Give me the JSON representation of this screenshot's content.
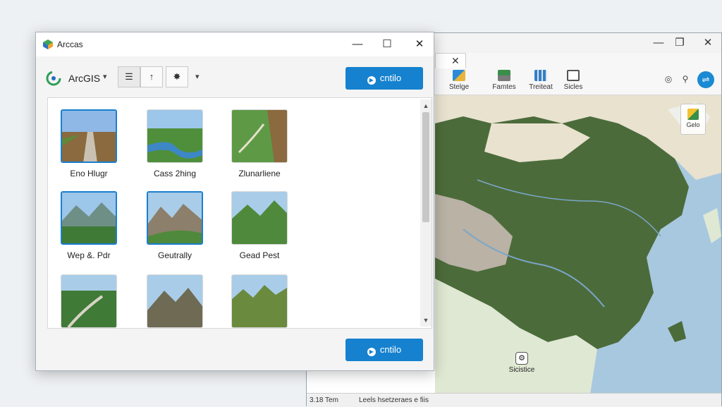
{
  "background_app": {
    "title_controls": {
      "minimize": "—",
      "maximize": "❐",
      "close": "✕"
    },
    "tab_close": "✕",
    "ribbon": [
      {
        "label": "Stelge",
        "icon": "cube-icon"
      },
      {
        "label": "Famtes",
        "icon": "layers-icon"
      },
      {
        "label": "Treiteat",
        "icon": "table-icon"
      },
      {
        "label": "Sicles",
        "icon": "select-icon"
      }
    ],
    "map_widget_label": "Gelo",
    "map_marker_label": "Sicistice",
    "status_left": "3.18 Tem",
    "status_mid": "Leels hsetzeraes e fiis",
    "colors": {
      "land": "#4c6b3a",
      "water": "#a8c8e0",
      "desert": "#e9e2cf",
      "accent": "#1a8ad4"
    }
  },
  "dialog": {
    "title": "Arccas",
    "controls": {
      "minimize": "—",
      "maximize": "☐",
      "close": "✕"
    },
    "brand": {
      "label": "ArcGIS",
      "chevron": "▾"
    },
    "toolbar": {
      "list_icon": "list-icon",
      "up_icon": "up-arrow-icon",
      "settings_icon": "gear-icon",
      "more_chevron": "▾"
    },
    "top_button": {
      "label": "cntilo",
      "icon": "play-icon"
    },
    "bottom_button": {
      "label": "cntilo",
      "icon": "play-icon"
    },
    "tiles": [
      {
        "label": "Eno Hlugr",
        "selected": true,
        "scene": "path"
      },
      {
        "label": "Cass 2hing",
        "selected": false,
        "scene": "river"
      },
      {
        "label": "Zlunarliene",
        "selected": false,
        "scene": "canyon"
      },
      {
        "label": "Wep &. Pdr",
        "selected": true,
        "scene": "mountain"
      },
      {
        "label": "Geutrally",
        "selected": true,
        "scene": "valley"
      },
      {
        "label": "Gead Pest",
        "selected": false,
        "scene": "hills"
      },
      {
        "label": "",
        "selected": false,
        "scene": "road"
      },
      {
        "label": "",
        "selected": false,
        "scene": "peaks"
      },
      {
        "label": "",
        "selected": false,
        "scene": "ridge"
      }
    ],
    "scroll": {
      "up": "▲",
      "down": "▼"
    },
    "colors": {
      "accent": "#1682cf",
      "selection": "#1a7fd0"
    }
  }
}
